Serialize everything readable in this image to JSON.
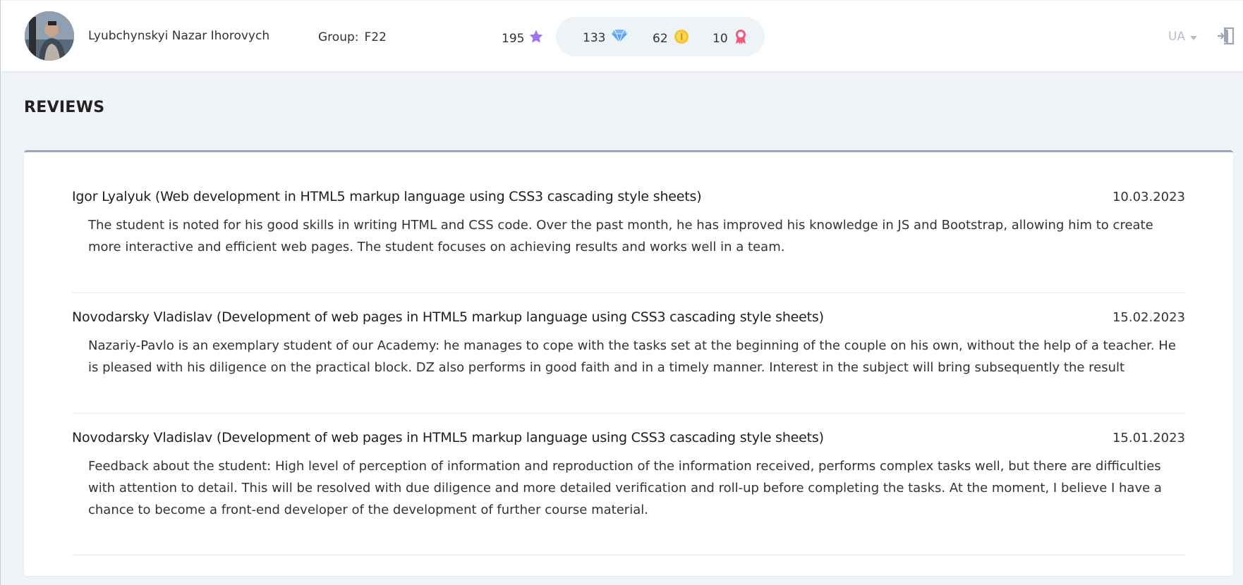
{
  "header": {
    "user_name": "Lyubchynskyi Nazar Ihorovych",
    "group_label": "Group:",
    "group_value": "F22",
    "stars": "195",
    "diamonds": "133",
    "coins": "62",
    "badges": "10",
    "language": "UA",
    "icons": [
      "star-icon",
      "diamond-icon",
      "coin-icon",
      "badge-icon",
      "chevron-down-icon",
      "exit-icon"
    ],
    "colors": {
      "star": "#a074ee",
      "diamond": "#5fa2ef",
      "coin": "#f5c52c",
      "badge": "#ef5b79"
    }
  },
  "page": {
    "title": "REVIEWS"
  },
  "reviews": [
    {
      "author": "Igor Lyalyuk (Web development in HTML5 markup language using CSS3 cascading style sheets)",
      "date": "10.03.2023",
      "text": "The student is noted for his good skills in writing HTML and CSS code. Over the past month, he has improved his knowledge in JS and Bootstrap, allowing him to create more interactive and efficient web pages. The student focuses on achieving results and works well in a team."
    },
    {
      "author": "Novodarsky Vladislav (Development of web pages in HTML5 markup language using CSS3 cascading style sheets)",
      "date": "15.02.2023",
      "text": "Nazariy-Pavlo is an exemplary student of our Academy: he manages to cope with the tasks set at the beginning of the couple on his own, without the help of a teacher. He is pleased with his diligence on the practical block. DZ also performs in good faith and in a timely manner. Interest in the subject will bring subsequently the result"
    },
    {
      "author": "Novodarsky Vladislav (Development of web pages in HTML5 markup language using CSS3 cascading style sheets)",
      "date": "15.01.2023",
      "text": "Feedback about the student: High level of perception of information and reproduction of the information received, performs complex tasks well, but there are difficulties with attention to detail. This will be resolved with due diligence and more detailed verification and roll-up before completing the tasks. At the moment, I believe I have a chance to become a front-end developer of the development of further course material."
    }
  ]
}
